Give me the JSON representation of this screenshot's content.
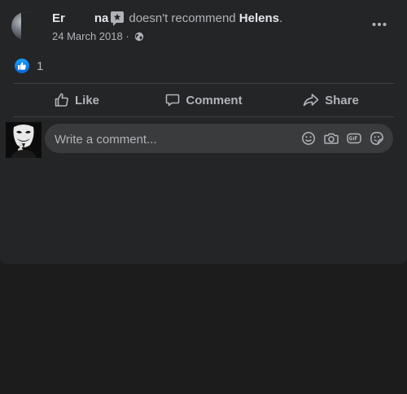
{
  "post": {
    "author_name": "Er",
    "author_name_end": "na",
    "recommend_text": "doesn't recommend",
    "page_name": "Helens",
    "page_name_suffix": ".",
    "date": "24 March 2018",
    "separator": "·",
    "privacy_icon": "globe-icon",
    "more_icon": "more-dots-icon"
  },
  "reactions": {
    "icon": "like-reaction-icon",
    "count": "1"
  },
  "actions": {
    "like_label": "Like",
    "comment_label": "Comment",
    "share_label": "Share"
  },
  "comment": {
    "placeholder": "Write a comment...",
    "icons": [
      "emoji-icon",
      "camera-icon",
      "gif-icon",
      "sticker-icon"
    ]
  },
  "colors": {
    "card_bg": "#242526",
    "page_bg": "#1c1c1d",
    "input_bg": "#3a3b3c",
    "text_primary": "#e4e6eb",
    "text_secondary": "#b0b3b8",
    "like_blue": "#1877f2"
  }
}
